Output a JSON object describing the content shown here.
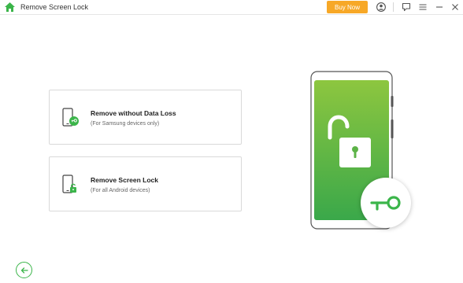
{
  "window": {
    "title": "Remove Screen Lock",
    "buy_label": "Buy Now",
    "icons": [
      "home-icon",
      "account-icon",
      "feedback-icon",
      "menu-icon",
      "minimize-icon",
      "close-icon"
    ]
  },
  "options": [
    {
      "title": "Remove without Data Loss",
      "subtitle": "(For Samsung devices only)",
      "icon": "phone-key-icon"
    },
    {
      "title": "Remove Screen Lock",
      "subtitle": "(For all Android devices)",
      "icon": "phone-lock-icon"
    }
  ],
  "illustration": {
    "icons": [
      "phone-illustration",
      "open-padlock-icon",
      "key-icon"
    ]
  },
  "footer": {
    "back_icon": "back-arrow-icon"
  },
  "colors": {
    "accent_green": "#3bb54a",
    "screen_green_top": "#8dc63f",
    "screen_green_bottom": "#3aa84a",
    "buy_orange": "#f7a827"
  }
}
